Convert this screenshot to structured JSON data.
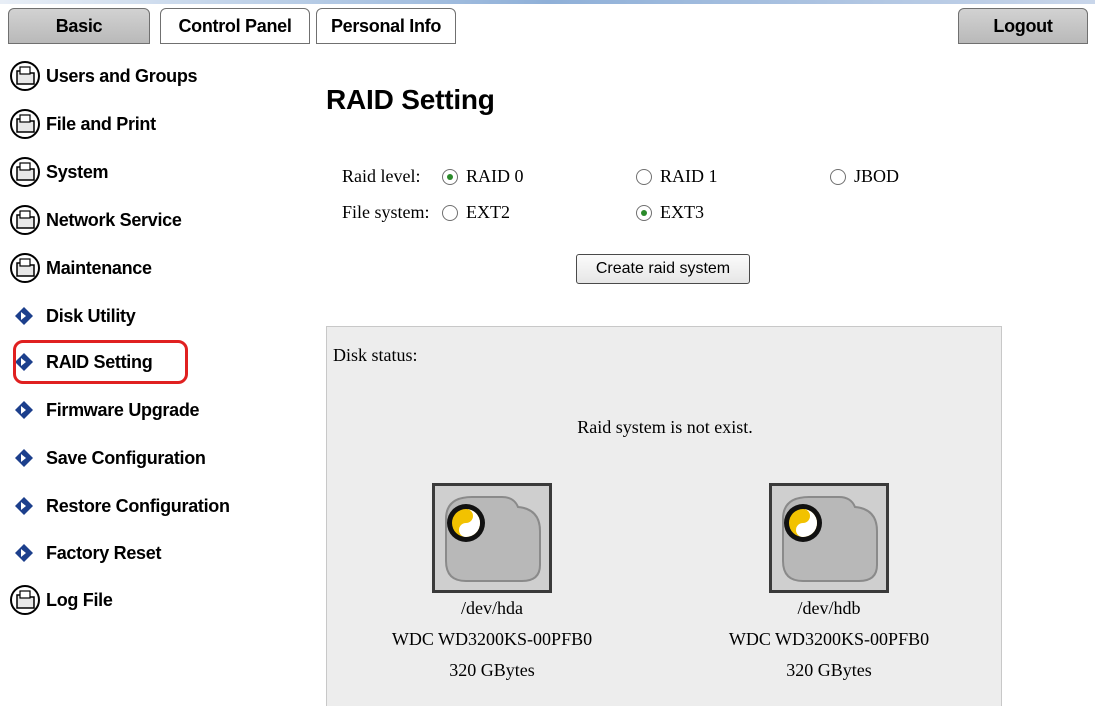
{
  "tabs": {
    "basic": "Basic",
    "control_panel": "Control Panel",
    "personal_info": "Personal Info",
    "logout": "Logout"
  },
  "sidebar": {
    "items": [
      {
        "label": "Users and Groups",
        "icon": "folder-icon"
      },
      {
        "label": "File and Print",
        "icon": "folder-icon"
      },
      {
        "label": "System",
        "icon": "folder-icon"
      },
      {
        "label": "Network Service",
        "icon": "folder-icon"
      },
      {
        "label": "Maintenance",
        "icon": "folder-icon"
      },
      {
        "label": "Disk Utility",
        "icon": "arrow-icon"
      },
      {
        "label": "RAID Setting",
        "icon": "arrow-icon",
        "selected": true
      },
      {
        "label": "Firmware Upgrade",
        "icon": "arrow-icon"
      },
      {
        "label": "Save Configuration",
        "icon": "arrow-icon"
      },
      {
        "label": "Restore Configuration",
        "icon": "arrow-icon"
      },
      {
        "label": "Factory Reset",
        "icon": "arrow-icon"
      },
      {
        "label": "Log File",
        "icon": "folder-icon"
      }
    ],
    "highlight_color": "#e02020"
  },
  "main": {
    "title": "RAID Setting",
    "raid_level_label": "Raid level:",
    "raid_levels": [
      {
        "label": "RAID 0",
        "checked": true
      },
      {
        "label": "RAID 1",
        "checked": false
      },
      {
        "label": "JBOD",
        "checked": false
      }
    ],
    "file_system_label": "File system:",
    "file_systems": [
      {
        "label": "EXT2",
        "checked": false
      },
      {
        "label": "EXT3",
        "checked": true
      }
    ],
    "create_button": "Create raid system",
    "disk_status": {
      "label": "Disk status:",
      "message": "Raid system is not exist.",
      "disks": [
        {
          "device": "/dev/hda",
          "model": "WDC WD3200KS-00PFB0",
          "size": "320 GBytes",
          "icon": "hard-disk-icon"
        },
        {
          "device": "/dev/hdb",
          "model": "WDC WD3200KS-00PFB0",
          "size": "320 GBytes",
          "icon": "hard-disk-icon"
        }
      ]
    }
  }
}
